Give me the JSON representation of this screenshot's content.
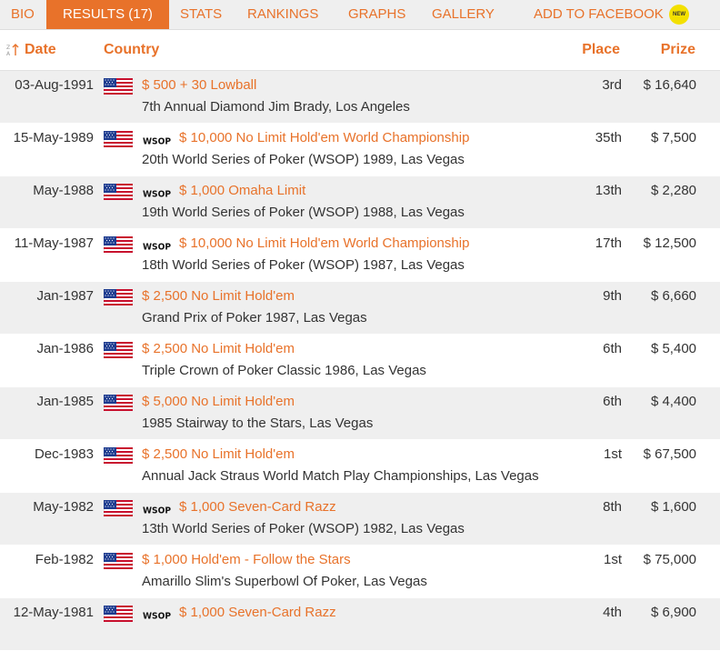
{
  "tabs": [
    {
      "label": "BIO",
      "active": false
    },
    {
      "label": "RESULTS (17)",
      "active": true
    },
    {
      "label": "STATS",
      "active": false
    },
    {
      "label": "RANKINGS",
      "active": false
    },
    {
      "label": "GRAPHS",
      "active": false
    },
    {
      "label": "GALLERY",
      "active": false
    },
    {
      "label": "ADD TO FACEBOOK",
      "active": false
    }
  ],
  "new_badge": "NEW",
  "wsop_label": "WSOP",
  "columns": {
    "date": "Date",
    "country": "Country",
    "place": "Place",
    "prize": "Prize"
  },
  "rows": [
    {
      "date": "03-Aug-1991",
      "wsop": false,
      "event": "$ 500 + 30 Lowball",
      "venue": "7th Annual Diamond Jim Brady, Los Angeles",
      "place": "3rd",
      "prize": "$ 16,640"
    },
    {
      "date": "15-May-1989",
      "wsop": true,
      "event": "$ 10,000 No Limit Hold'em World Championship",
      "venue": "20th World Series of Poker (WSOP) 1989, Las Vegas",
      "place": "35th",
      "prize": "$ 7,500"
    },
    {
      "date": "May-1988",
      "wsop": true,
      "event": "$ 1,000 Omaha Limit",
      "venue": "19th World Series of Poker (WSOP) 1988, Las Vegas",
      "place": "13th",
      "prize": "$ 2,280"
    },
    {
      "date": "11-May-1987",
      "wsop": true,
      "event": "$ 10,000 No Limit Hold'em World Championship",
      "venue": "18th World Series of Poker (WSOP) 1987, Las Vegas",
      "place": "17th",
      "prize": "$ 12,500"
    },
    {
      "date": "Jan-1987",
      "wsop": false,
      "event": "$ 2,500 No Limit Hold'em",
      "venue": "Grand Prix of Poker 1987, Las Vegas",
      "place": "9th",
      "prize": "$ 6,660"
    },
    {
      "date": "Jan-1986",
      "wsop": false,
      "event": "$ 2,500 No Limit Hold'em",
      "venue": "Triple Crown of Poker Classic 1986, Las Vegas",
      "place": "6th",
      "prize": "$ 5,400"
    },
    {
      "date": "Jan-1985",
      "wsop": false,
      "event": "$ 5,000 No Limit Hold'em",
      "venue": "1985 Stairway to the Stars, Las Vegas",
      "place": "6th",
      "prize": "$ 4,400"
    },
    {
      "date": "Dec-1983",
      "wsop": false,
      "event": "$ 2,500 No Limit Hold'em",
      "venue": "Annual Jack Straus World Match Play Championships, Las Vegas",
      "place": "1st",
      "prize": "$ 67,500"
    },
    {
      "date": "May-1982",
      "wsop": true,
      "event": "$ 1,000 Seven-Card Razz",
      "venue": "13th World Series of Poker (WSOP) 1982, Las Vegas",
      "place": "8th",
      "prize": "$ 1,600"
    },
    {
      "date": "Feb-1982",
      "wsop": false,
      "event": "$ 1,000 Hold'em - Follow the Stars",
      "venue": "Amarillo Slim's Superbowl Of Poker, Las Vegas",
      "place": "1st",
      "prize": "$ 75,000"
    },
    {
      "date": "12-May-1981",
      "wsop": true,
      "event": "$ 1,000 Seven-Card Razz",
      "venue": "",
      "place": "4th",
      "prize": "$ 6,900"
    }
  ],
  "colors": {
    "accent": "#e8722a",
    "row_alt": "#efefef",
    "badge": "#f3e000"
  },
  "icons": {
    "sort": "sort-az-icon",
    "flag": "us-flag-icon",
    "wsop": "wsop-logo-icon",
    "new": "new-badge-icon"
  }
}
